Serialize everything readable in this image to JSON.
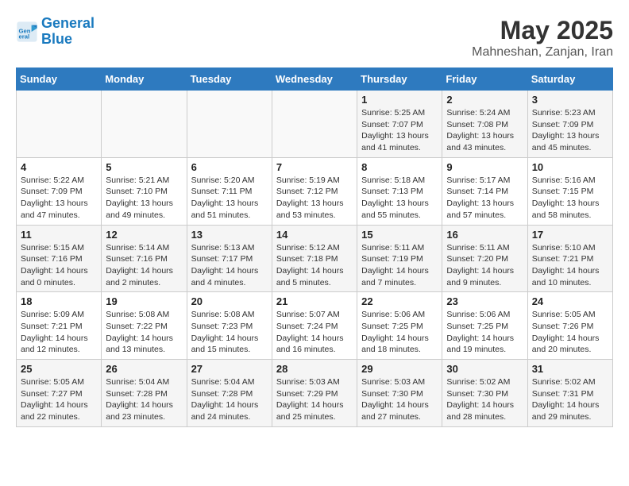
{
  "logo": {
    "name_part1": "General",
    "name_part2": "Blue"
  },
  "title": "May 2025",
  "subtitle": "Mahneshan, Zanjan, Iran",
  "headers": [
    "Sunday",
    "Monday",
    "Tuesday",
    "Wednesday",
    "Thursday",
    "Friday",
    "Saturday"
  ],
  "weeks": [
    [
      {
        "day": "",
        "info": ""
      },
      {
        "day": "",
        "info": ""
      },
      {
        "day": "",
        "info": ""
      },
      {
        "day": "",
        "info": ""
      },
      {
        "day": "1",
        "info": "Sunrise: 5:25 AM\nSunset: 7:07 PM\nDaylight: 13 hours\nand 41 minutes."
      },
      {
        "day": "2",
        "info": "Sunrise: 5:24 AM\nSunset: 7:08 PM\nDaylight: 13 hours\nand 43 minutes."
      },
      {
        "day": "3",
        "info": "Sunrise: 5:23 AM\nSunset: 7:09 PM\nDaylight: 13 hours\nand 45 minutes."
      }
    ],
    [
      {
        "day": "4",
        "info": "Sunrise: 5:22 AM\nSunset: 7:09 PM\nDaylight: 13 hours\nand 47 minutes."
      },
      {
        "day": "5",
        "info": "Sunrise: 5:21 AM\nSunset: 7:10 PM\nDaylight: 13 hours\nand 49 minutes."
      },
      {
        "day": "6",
        "info": "Sunrise: 5:20 AM\nSunset: 7:11 PM\nDaylight: 13 hours\nand 51 minutes."
      },
      {
        "day": "7",
        "info": "Sunrise: 5:19 AM\nSunset: 7:12 PM\nDaylight: 13 hours\nand 53 minutes."
      },
      {
        "day": "8",
        "info": "Sunrise: 5:18 AM\nSunset: 7:13 PM\nDaylight: 13 hours\nand 55 minutes."
      },
      {
        "day": "9",
        "info": "Sunrise: 5:17 AM\nSunset: 7:14 PM\nDaylight: 13 hours\nand 57 minutes."
      },
      {
        "day": "10",
        "info": "Sunrise: 5:16 AM\nSunset: 7:15 PM\nDaylight: 13 hours\nand 58 minutes."
      }
    ],
    [
      {
        "day": "11",
        "info": "Sunrise: 5:15 AM\nSunset: 7:16 PM\nDaylight: 14 hours\nand 0 minutes."
      },
      {
        "day": "12",
        "info": "Sunrise: 5:14 AM\nSunset: 7:16 PM\nDaylight: 14 hours\nand 2 minutes."
      },
      {
        "day": "13",
        "info": "Sunrise: 5:13 AM\nSunset: 7:17 PM\nDaylight: 14 hours\nand 4 minutes."
      },
      {
        "day": "14",
        "info": "Sunrise: 5:12 AM\nSunset: 7:18 PM\nDaylight: 14 hours\nand 5 minutes."
      },
      {
        "day": "15",
        "info": "Sunrise: 5:11 AM\nSunset: 7:19 PM\nDaylight: 14 hours\nand 7 minutes."
      },
      {
        "day": "16",
        "info": "Sunrise: 5:11 AM\nSunset: 7:20 PM\nDaylight: 14 hours\nand 9 minutes."
      },
      {
        "day": "17",
        "info": "Sunrise: 5:10 AM\nSunset: 7:21 PM\nDaylight: 14 hours\nand 10 minutes."
      }
    ],
    [
      {
        "day": "18",
        "info": "Sunrise: 5:09 AM\nSunset: 7:21 PM\nDaylight: 14 hours\nand 12 minutes."
      },
      {
        "day": "19",
        "info": "Sunrise: 5:08 AM\nSunset: 7:22 PM\nDaylight: 14 hours\nand 13 minutes."
      },
      {
        "day": "20",
        "info": "Sunrise: 5:08 AM\nSunset: 7:23 PM\nDaylight: 14 hours\nand 15 minutes."
      },
      {
        "day": "21",
        "info": "Sunrise: 5:07 AM\nSunset: 7:24 PM\nDaylight: 14 hours\nand 16 minutes."
      },
      {
        "day": "22",
        "info": "Sunrise: 5:06 AM\nSunset: 7:25 PM\nDaylight: 14 hours\nand 18 minutes."
      },
      {
        "day": "23",
        "info": "Sunrise: 5:06 AM\nSunset: 7:25 PM\nDaylight: 14 hours\nand 19 minutes."
      },
      {
        "day": "24",
        "info": "Sunrise: 5:05 AM\nSunset: 7:26 PM\nDaylight: 14 hours\nand 20 minutes."
      }
    ],
    [
      {
        "day": "25",
        "info": "Sunrise: 5:05 AM\nSunset: 7:27 PM\nDaylight: 14 hours\nand 22 minutes."
      },
      {
        "day": "26",
        "info": "Sunrise: 5:04 AM\nSunset: 7:28 PM\nDaylight: 14 hours\nand 23 minutes."
      },
      {
        "day": "27",
        "info": "Sunrise: 5:04 AM\nSunset: 7:28 PM\nDaylight: 14 hours\nand 24 minutes."
      },
      {
        "day": "28",
        "info": "Sunrise: 5:03 AM\nSunset: 7:29 PM\nDaylight: 14 hours\nand 25 minutes."
      },
      {
        "day": "29",
        "info": "Sunrise: 5:03 AM\nSunset: 7:30 PM\nDaylight: 14 hours\nand 27 minutes."
      },
      {
        "day": "30",
        "info": "Sunrise: 5:02 AM\nSunset: 7:30 PM\nDaylight: 14 hours\nand 28 minutes."
      },
      {
        "day": "31",
        "info": "Sunrise: 5:02 AM\nSunset: 7:31 PM\nDaylight: 14 hours\nand 29 minutes."
      }
    ]
  ]
}
